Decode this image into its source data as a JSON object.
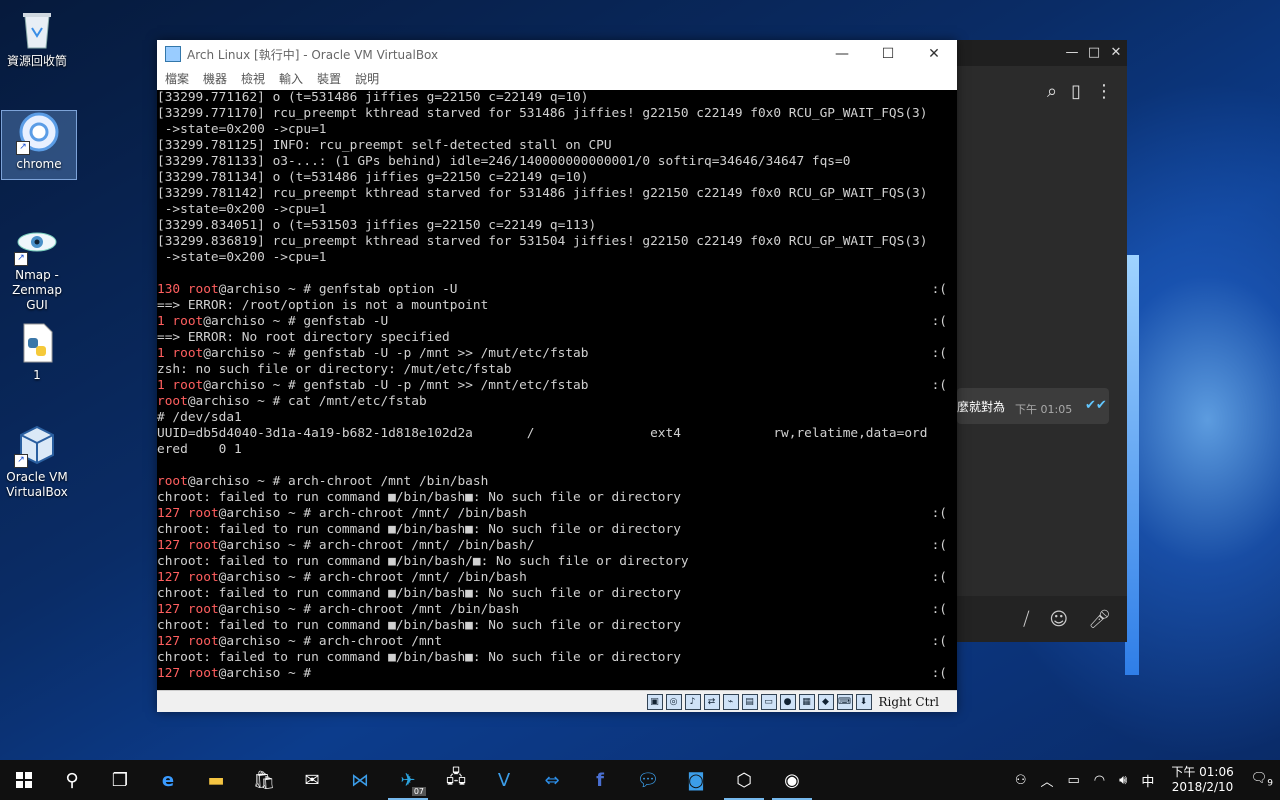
{
  "desktop": {
    "icons": [
      {
        "label": "資源回收筒",
        "icon": "recycle-bin-icon"
      },
      {
        "label": "chrome",
        "icon": "chrome-icon"
      },
      {
        "label": "Nmap -\nZenmap GUI",
        "icon": "nmap-eye-icon"
      },
      {
        "label": "1",
        "icon": "python-file-icon"
      },
      {
        "label": "Oracle VM\nVirtualBox",
        "icon": "virtualbox-cube-icon"
      }
    ]
  },
  "vbox": {
    "title": "Arch Linux [執行中] - Oracle VM VirtualBox",
    "menu": [
      "檔案",
      "機器",
      "檢視",
      "輸入",
      "裝置",
      "說明"
    ],
    "host_key": "Right Ctrl",
    "window_controls": [
      "minimize-icon",
      "maximize-icon",
      "close-icon"
    ]
  },
  "terminal": {
    "lines": [
      {
        "text": "[33299.771162] o (t=531486 jiffies g=22150 c=22149 q=10)"
      },
      {
        "text": "[33299.771170] rcu_preempt kthread starved for 531486 jiffies! g22150 c22149 f0x0 RCU_GP_WAIT_FQS(3)"
      },
      {
        "text": " ->state=0x200 ->cpu=1"
      },
      {
        "text": "[33299.781125] INFO: rcu_preempt self-detected stall on CPU"
      },
      {
        "text": "[33299.781133] o3-...: (1 GPs behind) idle=246/140000000000001/0 softirq=34646/34647 fqs=0"
      },
      {
        "text": "[33299.781134] o (t=531486 jiffies g=22150 c=22149 q=10)"
      },
      {
        "text": "[33299.781142] rcu_preempt kthread starved for 531486 jiffies! g22150 c22149 f0x0 RCU_GP_WAIT_FQS(3)"
      },
      {
        "text": " ->state=0x200 ->cpu=1"
      },
      {
        "text": "[33299.834051] o (t=531503 jiffies g=22150 c=22149 q=113)"
      },
      {
        "text": "[33299.836819] rcu_preempt kthread starved for 531504 jiffies! g22150 c22149 f0x0 RCU_GP_WAIT_FQS(3)"
      },
      {
        "text": " ->state=0x200 ->cpu=1"
      },
      {
        "text": ""
      },
      {
        "code": "130",
        "user": "root",
        "rest": "@archiso ~ # genfstab option -U",
        "rs": ":("
      },
      {
        "text": "==> ERROR: /root/option is not a mountpoint"
      },
      {
        "code": "1",
        "user": "root",
        "rest": "@archiso ~ # genfstab -U",
        "rs": ":("
      },
      {
        "text": "==> ERROR: No root directory specified"
      },
      {
        "code": "1",
        "user": "root",
        "rest": "@archiso ~ # genfstab -U -p /mnt >> /mut/etc/fstab",
        "rs": ":("
      },
      {
        "text": "zsh: no such file or directory: /mut/etc/fstab"
      },
      {
        "code": "1",
        "user": "root",
        "rest": "@archiso ~ # genfstab -U -p /mnt >> /mnt/etc/fstab",
        "rs": ":("
      },
      {
        "code": "",
        "user": "root",
        "rest": "@archiso ~ # cat /mnt/etc/fstab"
      },
      {
        "text": "# /dev/sda1"
      },
      {
        "text": "UUID=db5d4040-3d1a-4a19-b682-1d818e102d2a       /               ext4            rw,relatime,data=ord"
      },
      {
        "text": "ered    0 1"
      },
      {
        "text": ""
      },
      {
        "code": "",
        "user": "root",
        "rest": "@archiso ~ # arch-chroot /mnt /bin/bash"
      },
      {
        "text": "chroot: failed to run command ■/bin/bash■: No such file or directory"
      },
      {
        "code": "127",
        "user": "root",
        "rest": "@archiso ~ # arch-chroot /mnt/ /bin/bash",
        "rs": ":("
      },
      {
        "text": "chroot: failed to run command ■/bin/bash■: No such file or directory"
      },
      {
        "code": "127",
        "user": "root",
        "rest": "@archiso ~ # arch-chroot /mnt/ /bin/bash/",
        "rs": ":("
      },
      {
        "text": "chroot: failed to run command ■/bin/bash/■: No such file or directory"
      },
      {
        "code": "127",
        "user": "root",
        "rest": "@archiso ~ # arch-chroot /mnt/ /bin/bash",
        "rs": ":("
      },
      {
        "text": "chroot: failed to run command ■/bin/bash■: No such file or directory"
      },
      {
        "code": "127",
        "user": "root",
        "rest": "@archiso ~ # arch-chroot /mnt /bin/bash",
        "rs": ":("
      },
      {
        "text": "chroot: failed to run command ■/bin/bash■: No such file or directory"
      },
      {
        "code": "127",
        "user": "root",
        "rest": "@archiso ~ # arch-chroot /mnt",
        "rs": ":("
      },
      {
        "text": "chroot: failed to run command ■/bin/bash■: No such file or directory"
      },
      {
        "code": "127",
        "user": "root",
        "rest": "@archiso ~ #",
        "rs": ":("
      }
    ]
  },
  "chat": {
    "message": "麼就對為",
    "time": "下午 01:05",
    "colors": {
      "check": "#62c7ff"
    }
  },
  "taskbar": {
    "clock_time": "下午 01:06",
    "clock_date": "2018/2/10",
    "ime": "中",
    "telegram_badge": "07",
    "notification_count": "9"
  }
}
